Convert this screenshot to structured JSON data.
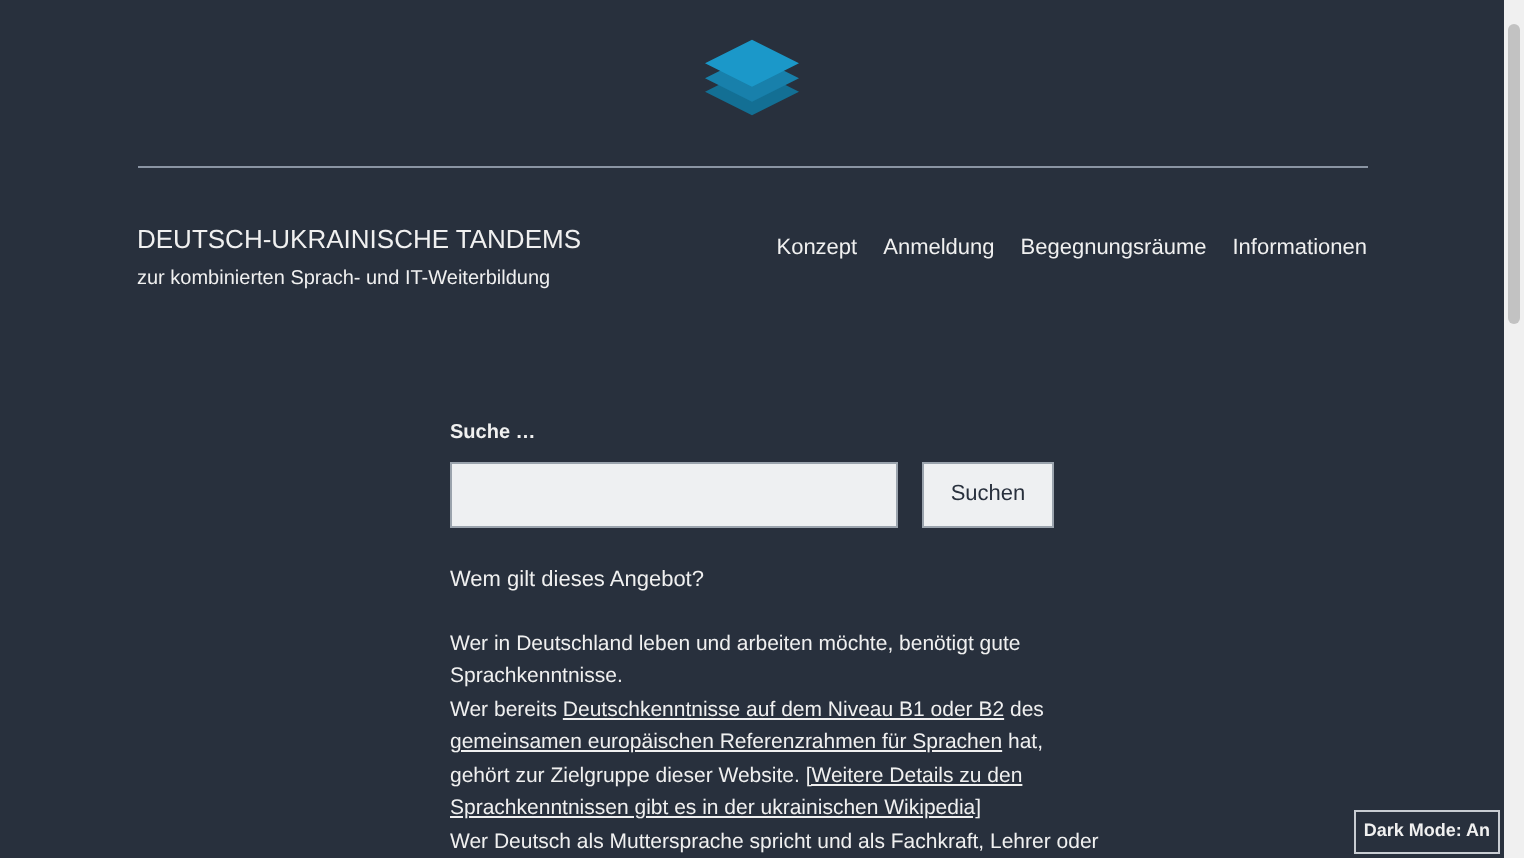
{
  "site": {
    "title": "DEUTSCH-UKRAINISCHE TANDEMS",
    "tagline": "zur kombinierten Sprach- und IT-Weiterbildung"
  },
  "nav": [
    {
      "label": "Konzept"
    },
    {
      "label": "Anmeldung"
    },
    {
      "label": "Begegnungsräume"
    },
    {
      "label": "Informationen"
    }
  ],
  "search": {
    "label": "Suche …",
    "button": "Suchen"
  },
  "heading": "Wem gilt dieses Angebot?",
  "paragraph_lines": [
    [
      {
        "kind": "text",
        "text": "Wer in Deutschland leben und arbeiten möchte, benötigt gute"
      }
    ],
    [
      {
        "kind": "text",
        "text": "Sprachkenntnisse."
      }
    ],
    [
      {
        "kind": "text",
        "text": "Wer bereits "
      },
      {
        "kind": "link",
        "text": "Deutschkenntnisse auf dem Niveau B1 oder B2"
      },
      {
        "kind": "text",
        "text": " des"
      }
    ],
    [
      {
        "kind": "link",
        "text": "gemeinsamen europäischen Referenzrahmen für Sprachen"
      },
      {
        "kind": "text",
        "text": " hat,"
      }
    ],
    [
      {
        "kind": "text",
        "text": "gehört zur Zielgruppe dieser Website. "
      },
      {
        "kind": "link",
        "text": "[Weitere Details zu den"
      }
    ],
    [
      {
        "kind": "link",
        "text": "Sprachkenntnissen gibt es in der ukrainischen Wikipedia]"
      }
    ],
    [
      {
        "kind": "text",
        "text": "Wer Deutsch als Muttersprache spricht und als Fachkraft, Lehrer oder"
      }
    ]
  ],
  "dark_mode_toggle": {
    "label": "Dark Mode: An"
  }
}
